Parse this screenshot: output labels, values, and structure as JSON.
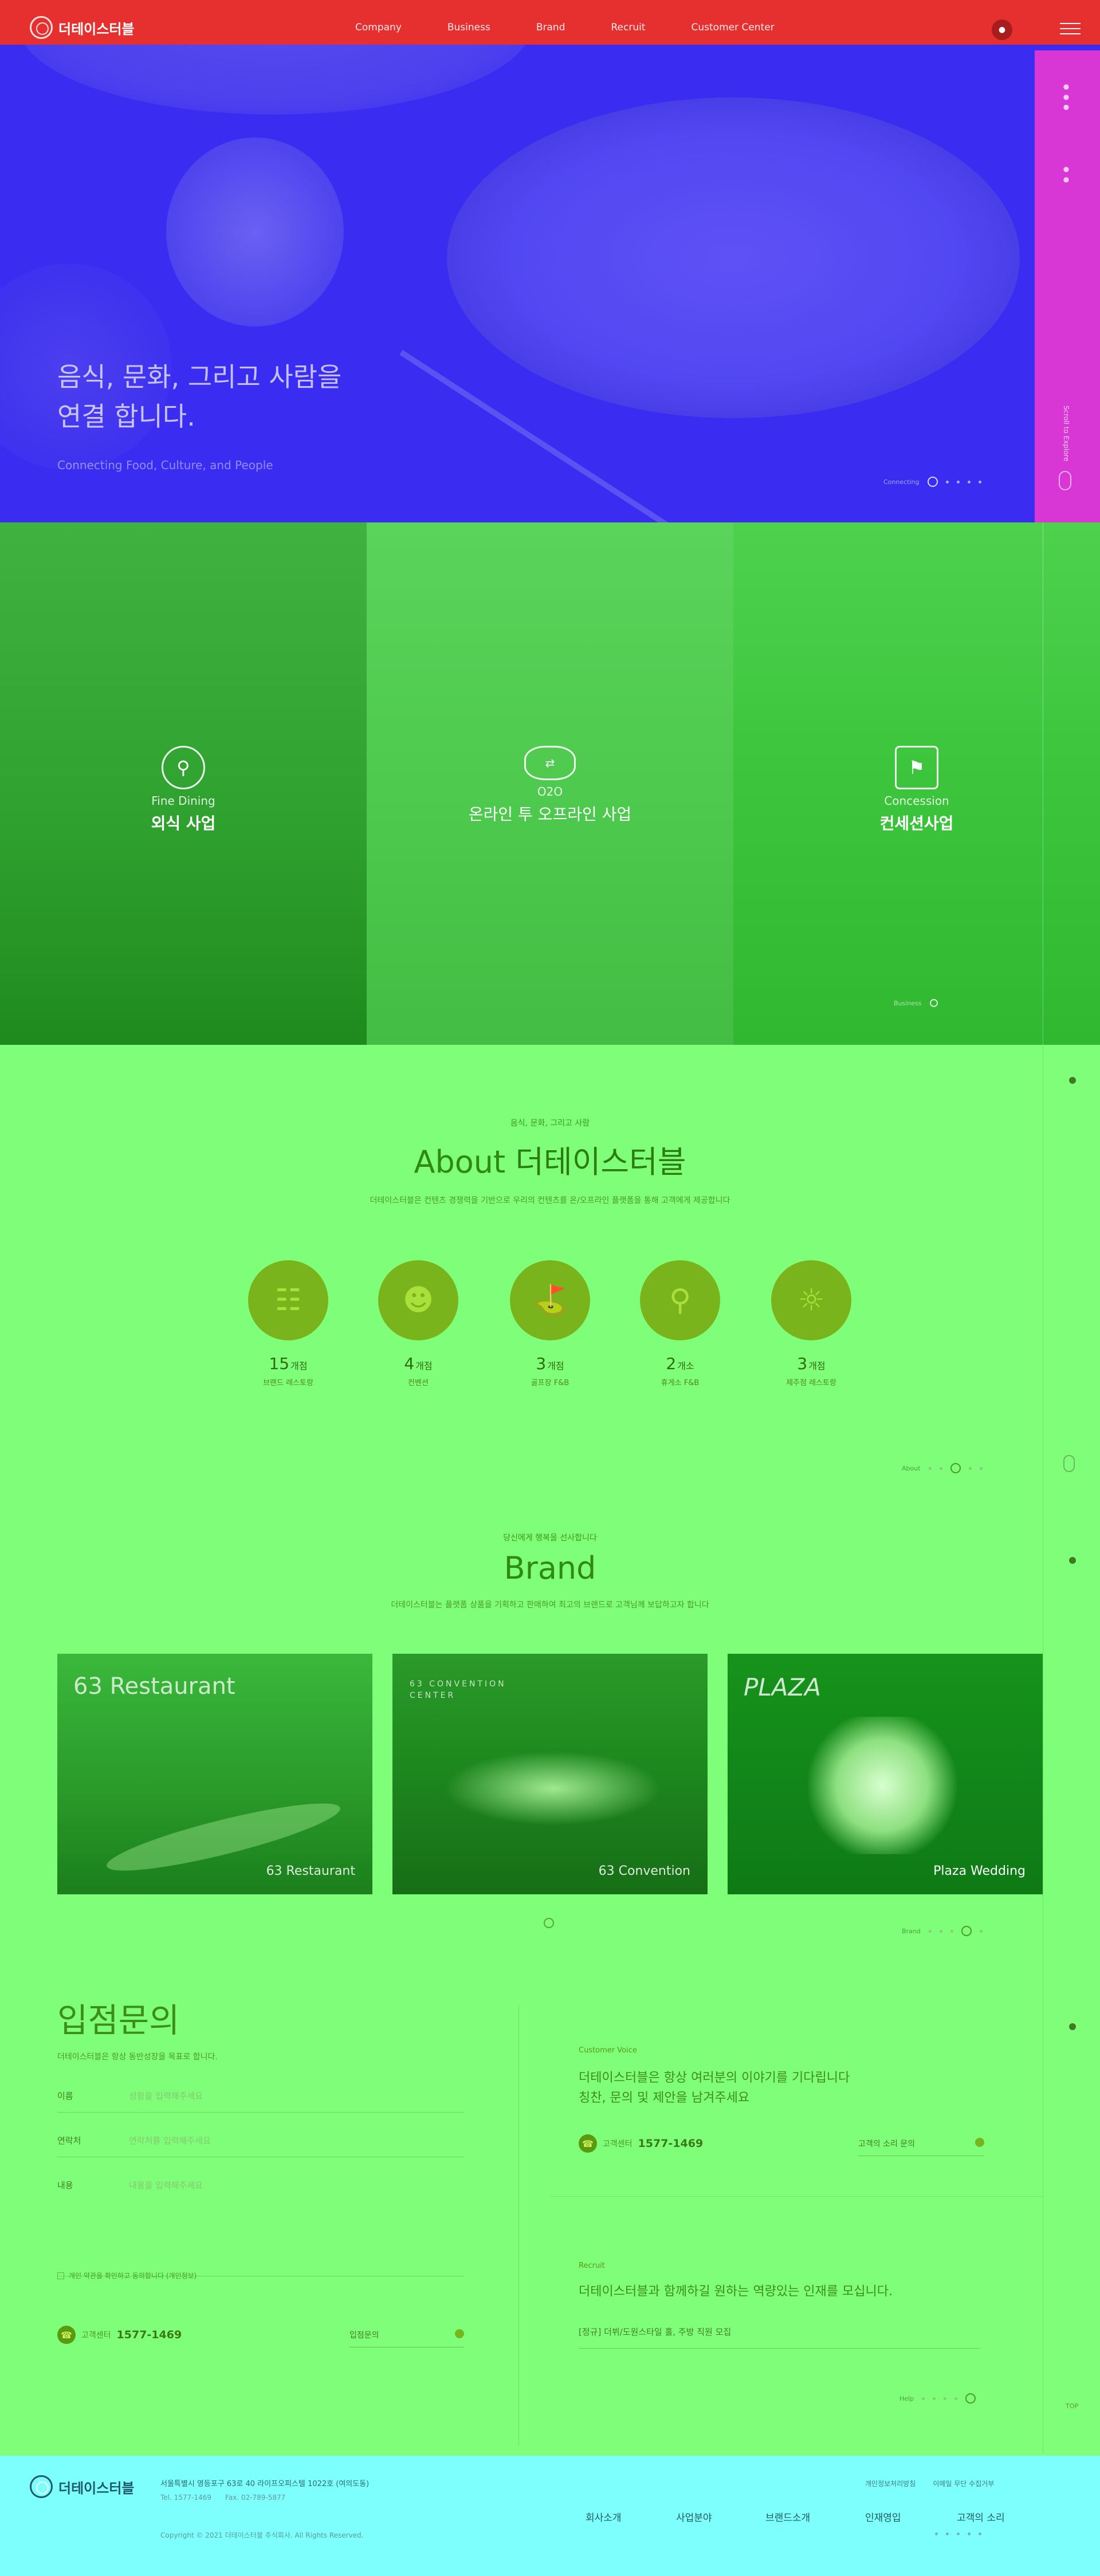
{
  "header": {
    "logo_text": "더테이스터블",
    "nav": [
      "Company",
      "Business",
      "Brand",
      "Recruit",
      "Customer Center"
    ]
  },
  "hero": {
    "title_line1": "음식, 문화, 그리고 사람을",
    "title_line2": "연결 합니다.",
    "subtitle": "Connecting Food, Culture, and People",
    "indicator_label": "Connecting",
    "side_scroll_label": "Scroll to Explore"
  },
  "business": {
    "panels": [
      {
        "eng": "Fine Dining",
        "kor": "외식 사업"
      },
      {
        "eng": "O2O",
        "kor": "온라인 투 오프라인 사업"
      },
      {
        "eng": "Concession",
        "kor": "컨세션사업"
      }
    ],
    "indicator_label": "Business"
  },
  "about": {
    "eyebrow": "음식, 문화, 그리고 사람",
    "title_prefix": "About",
    "title_brand": "더테이스터블",
    "desc": "더테이스터블은 컨텐츠 경쟁력을 기반으로 우리의 컨텐츠를 온/오프라인 플랫폼을 통해 고객에게 제공합니다",
    "stats": [
      {
        "value": "15",
        "unit": "개점",
        "label": "브랜드 레스토랑",
        "icon": "restaurant-icon"
      },
      {
        "value": "4",
        "unit": "개점",
        "label": "컨벤션",
        "icon": "convention-icon"
      },
      {
        "value": "3",
        "unit": "개점",
        "label": "골프장 F&B",
        "icon": "golf-icon"
      },
      {
        "value": "2",
        "unit": "개소",
        "label": "휴게소 F&B",
        "icon": "rest-area-icon"
      },
      {
        "value": "3",
        "unit": "개점",
        "label": "제주점 레스토랑",
        "icon": "jeju-icon"
      }
    ],
    "indicator_label": "About"
  },
  "brand": {
    "eyebrow": "당신에게 행복을 선사합니다",
    "title": "Brand",
    "desc": "더테이스터블는 플랫폼 상품을 기획하고 판매하여 최고의 브랜드로 고객님께 보답하고자 합니다",
    "cards": [
      {
        "logo": "63 Restaurant",
        "caption": "63 Restaurant"
      },
      {
        "logo": "63 CONVENTION CENTER",
        "caption": "63 Convention"
      },
      {
        "logo": "PLAZA",
        "caption": "Plaza Wedding"
      }
    ],
    "indicator_label": "Brand"
  },
  "inquiry": {
    "title": "입점문의",
    "desc": "더테이스터블은 항상 동반성장을 목표로 합니다.",
    "fields": [
      {
        "label": "이름",
        "placeholder": "성함을 입력해주세요"
      },
      {
        "label": "연락처",
        "placeholder": "연락처를 입력해주세요"
      },
      {
        "label": "내용",
        "placeholder": "내용을 입력해주세요"
      }
    ],
    "agree": "개인 약관을 확인하고 동의합니다 (개인정보)",
    "phone_label": "고객센터",
    "phone": "1577-1469",
    "submit": "입점문의"
  },
  "customer_voice": {
    "eyebrow": "Customer Voice",
    "line1": "더테이스터블은 항상 여러분의 이야기를 기다립니다",
    "line2": "칭찬, 문의 및 제안을 남겨주세요",
    "phone_label": "고객센터",
    "phone": "1577-1469",
    "link": "고객의 소리 문의"
  },
  "recruit": {
    "eyebrow": "Recruit",
    "line1": "더테이스터블과 함께하길 원하는 역량있는 인재를 모십니다.",
    "item": "[정규] 더뷔/도원스타일 홀, 주방 직원 모집",
    "indicator_label": "Help"
  },
  "top_label": "TOP",
  "footer": {
    "logo_text": "더테이스터블",
    "address": "서울특별시 영등포구 63로 40 라이프오피스텔 1022호 (여의도동)",
    "tel": "Tel. 1577-1469",
    "fax": "Fax. 02-789-5877",
    "copyright": "Copyright © 2021 더테이스터블 주식회사. All Rights Reserved.",
    "links": [
      "개인정보처리방침",
      "이메일 무단 수집거부"
    ],
    "nav": [
      "회사소개",
      "사업분야",
      "브랜드소개",
      "인재영입",
      "고객의 소리"
    ]
  },
  "colors": {
    "hero_bg": "#3a2cf0",
    "hero_bar": "#e62f2f",
    "hero_side": "#d936d6",
    "content_bg": "#7ffe7a",
    "footer_bg": "#7dfffe",
    "accent_green": "#7ab41c"
  }
}
